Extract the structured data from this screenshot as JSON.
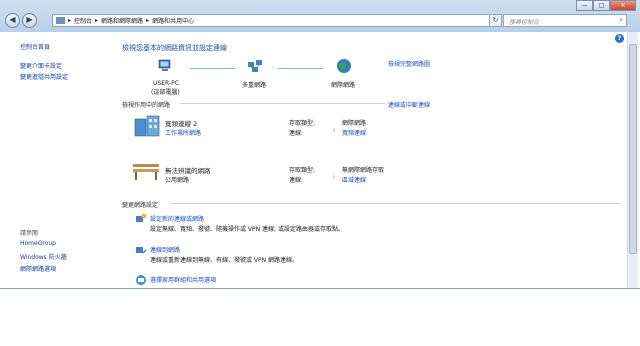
{
  "window": {
    "buttons": {
      "minimize": "—",
      "maximize": "□",
      "close": "✕"
    }
  },
  "nav": {
    "back": "◀",
    "forward": "▶"
  },
  "address": {
    "crumbs": [
      "控制台",
      "網路和網際網路",
      "網路和共用中心"
    ],
    "separator": "▸"
  },
  "search": {
    "placeholder": "搜尋控制台"
  },
  "sidebar": {
    "items": [
      "控制台首頁",
      "變更介面卡設定",
      "變更進階共用設定"
    ],
    "see_also": "請參閱",
    "related": [
      "HomeGroup",
      "Windows 防火牆",
      "網際網路選項"
    ]
  },
  "main": {
    "title": "檢視您基本的網路資訊並設定連線",
    "full_map": "檢視完整網路圖",
    "map": {
      "computer": "USER-PC",
      "computer_sub": "(這部電腦)",
      "multi": "多重網路",
      "internet": "網際網路"
    },
    "active_title": "檢視作用中的網路",
    "connect_disconnect": "連線或中斷連線",
    "networks": [
      {
        "name": "寬頻連線 2",
        "type": "工作場所網路",
        "access_label": "存取類型:",
        "access_value": "網際網路",
        "conn_label": "連線:",
        "conn_value": "寬頻連線"
      },
      {
        "name": "無法辨識的網路",
        "type": "公用網路",
        "access_label": "存取類型:",
        "access_value": "無網際網路存取",
        "conn_label": "連線:",
        "conn_value": "區域連線"
      }
    ],
    "change_title": "變更網路設定",
    "tasks": [
      {
        "link": "設定新的連線或網路",
        "desc": "設定無線、寬頻、撥號、隨機操作或 VPN 連線; 或設定路由器或存取點。"
      },
      {
        "link": "連線到網路",
        "desc": "連線或重新連線到無線、有線、撥號或 VPN 網路連線。"
      },
      {
        "link": "選擇家用群組和共用選項",
        "desc": ""
      }
    ]
  },
  "colors": {
    "link": "#1a4fb8",
    "heading": "#1b4f9c"
  }
}
